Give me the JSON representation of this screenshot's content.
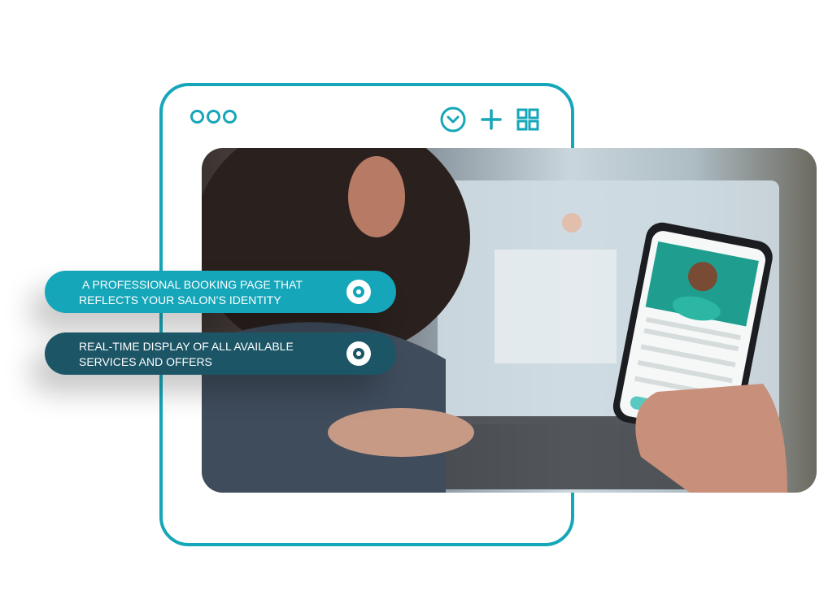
{
  "window": {
    "accent_color": "#16a6b9",
    "window_dots": [
      "dot",
      "dot",
      "dot"
    ],
    "icons": [
      "chevron-down-circle-icon",
      "plus-icon",
      "grid-icon"
    ]
  },
  "photo": {
    "description_tag": "person-using-laptop-and-phone-booking-app"
  },
  "features": [
    {
      "label": "A PROFESSIONAL BOOKING PAGE THAT REFLECTS YOUR SALON’S IDENTITY",
      "color": "#16a6b9"
    },
    {
      "label": "REAL-TIME DISPLAY OF ALL AVAILABLE SERVICES AND OFFERS",
      "color": "#1c5566"
    }
  ]
}
